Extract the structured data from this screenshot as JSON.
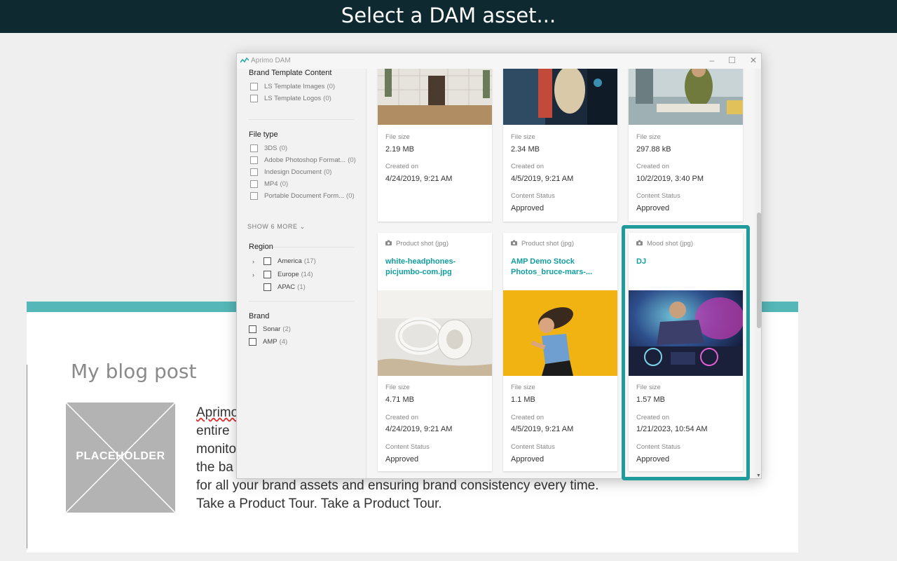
{
  "banner": {
    "title": "Select a DAM asset..."
  },
  "blog": {
    "title": "My blog post",
    "placeholder_label": "PLACEHOLDER",
    "lines": [
      "Aprimo",
      "entire",
      "monito",
      "the ba",
      "for all your brand assets and ensuring brand consistency every time.",
      "Take a Product Tour. Take a Product Tour."
    ]
  },
  "dialog": {
    "title": "Aprimo DAM",
    "controls": {
      "minimize": "–",
      "maximize": "☐",
      "close": "✕"
    },
    "filters": {
      "brand_template": {
        "title": "Brand Template Content",
        "items": [
          {
            "label": "LS Template Images",
            "count": "(0)"
          },
          {
            "label": "LS Template Logos",
            "count": "(0)"
          }
        ]
      },
      "file_type": {
        "title": "File type",
        "items": [
          {
            "label": "3DS",
            "count": "(0)"
          },
          {
            "label": "Adobe Photoshop Format...",
            "count": "(0)"
          },
          {
            "label": "Indesign Document",
            "count": "(0)"
          },
          {
            "label": "MP4",
            "count": "(0)"
          },
          {
            "label": "Portable Document Form...",
            "count": "(0)"
          }
        ],
        "show_more": "SHOW 6 MORE"
      },
      "region": {
        "title": "Region",
        "items": [
          {
            "label": "America",
            "count": "(17)"
          },
          {
            "label": "Europe",
            "count": "(14)"
          },
          {
            "label": "APAC",
            "count": "(1)"
          }
        ]
      },
      "brand": {
        "title": "Brand",
        "items": [
          {
            "label": "Sonar",
            "count": "(2)"
          },
          {
            "label": "AMP",
            "count": "(4)"
          }
        ]
      }
    },
    "labels": {
      "file_size": "File size",
      "created_on": "Created on",
      "content_status": "Content Status"
    },
    "cards_top": [
      {
        "file_size": "2.19 MB",
        "created_on": "4/24/2019, 9:21 AM"
      },
      {
        "file_size": "2.34 MB",
        "created_on": "4/5/2019, 9:21 AM",
        "status": "Approved"
      },
      {
        "file_size": "297.88 kB",
        "created_on": "10/2/2019, 3:40 PM",
        "status": "Approved"
      }
    ],
    "cards_bottom": [
      {
        "type": "Product shot (jpg)",
        "name": "white-headphones-picjumbo-com.jpg",
        "file_size": "4.71 MB",
        "created_on": "4/24/2019, 9:21 AM",
        "status": "Approved"
      },
      {
        "type": "Product shot (jpg)",
        "name": "AMP Demo Stock Photos_bruce-mars-...",
        "file_size": "1.1 MB",
        "created_on": "4/5/2019, 9:21 AM",
        "status": "Approved"
      },
      {
        "type": "Mood shot (jpg)",
        "name": "DJ",
        "file_size": "1.57 MB",
        "created_on": "1/21/2023, 10:54 AM",
        "status": "Approved"
      }
    ]
  },
  "colors": {
    "banner": "#0e2a30",
    "accent": "#1f9b9b",
    "link": "#129e9e"
  }
}
